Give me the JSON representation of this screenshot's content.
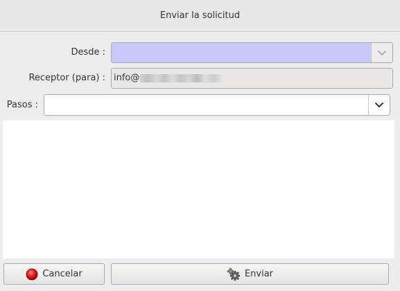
{
  "window": {
    "title": "Enviar la solicitud"
  },
  "form": {
    "desde_label": "Desde :",
    "desde_value": "",
    "receptor_label": "Receptor (para) :",
    "receptor_value": "info@",
    "pasos_label": "Pasos :",
    "pasos_value": "",
    "message_text": ""
  },
  "buttons": {
    "cancel_label": "Cancelar",
    "send_label": "Enviar"
  },
  "colors": {
    "desde_background": "#c8c8fa",
    "cancel_icon": "#e01b1b",
    "window_background": "#ededed"
  },
  "icons": {
    "cancel": "red-circle-icon",
    "send": "gears-icon",
    "dropdown": "chevron-down-icon"
  }
}
